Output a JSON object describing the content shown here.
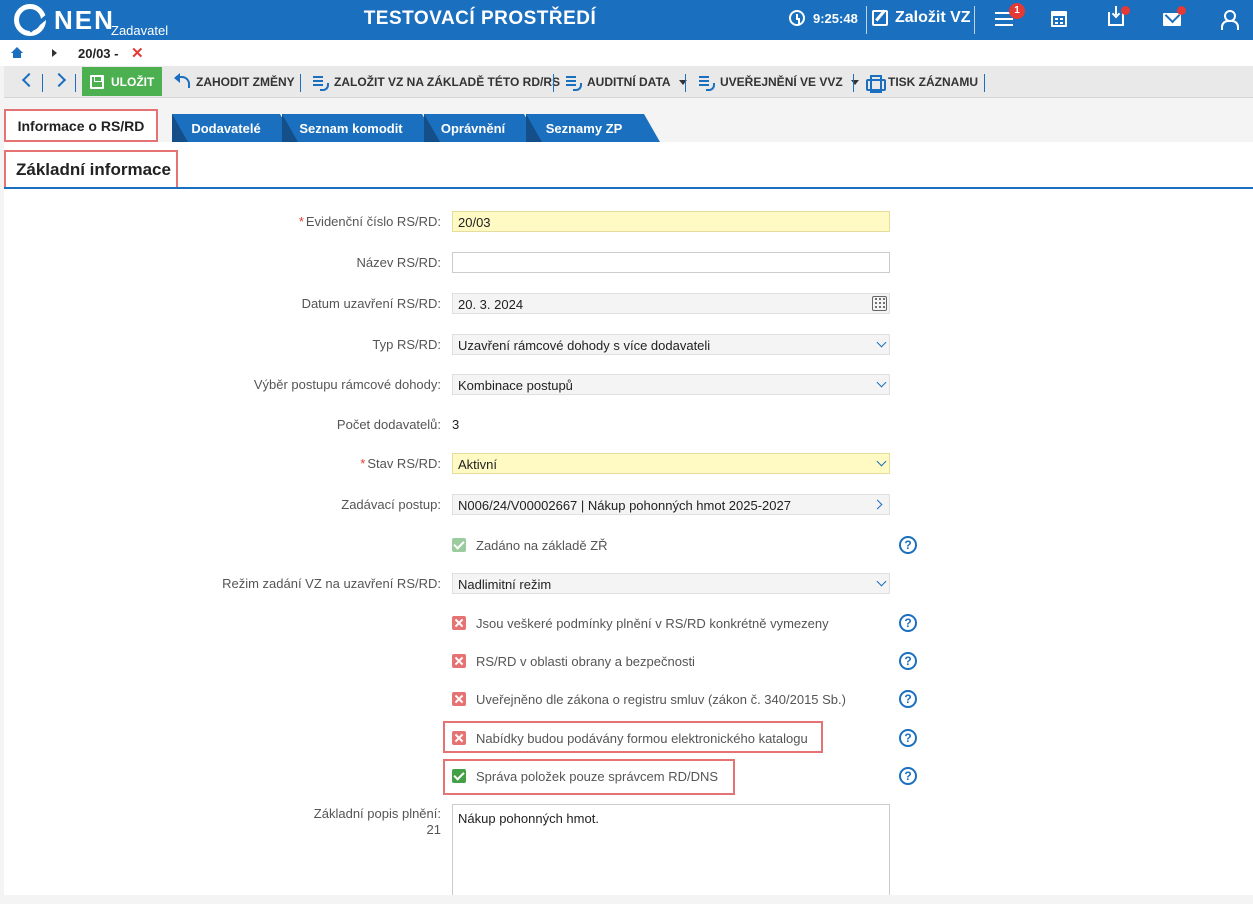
{
  "header": {
    "logo": "NEN",
    "logo_sub": "Zadavatel",
    "env_title": "TESTOVACÍ PROSTŘEDÍ",
    "time": "9:25:48",
    "create_label": "Založit VZ",
    "menu_badge": "1",
    "icons": [
      "clock-icon",
      "edit-icon",
      "menu-icon",
      "calculator-icon",
      "inbox-icon",
      "mail-icon",
      "user-icon"
    ],
    "accent_color": "#1b6fbf"
  },
  "breadcrumb": {
    "current": "20/03 -"
  },
  "toolbar": {
    "save": "ULOŽIT",
    "discard": "ZAHODIT ZMĚNY",
    "create_from": "ZALOŽIT VZ NA ZÁKLADĚ TÉTO RD/RS",
    "audit": "AUDITNÍ DATA",
    "publish": "UVEŘEJNĚNÍ VE VVZ",
    "print": "TISK ZÁZNAMU"
  },
  "tabs": {
    "active": "Informace o RS/RD",
    "items": [
      "Dodavatelé",
      "Seznam komodit",
      "Oprávnění",
      "Seznamy ZP"
    ]
  },
  "section": {
    "title": "Základní informace"
  },
  "form": {
    "evidencni_label": "Evidenční číslo RS/RD:",
    "evidencni_value": "20/03",
    "nazev_label": "Název RS/RD:",
    "nazev_value": "",
    "datum_label": "Datum uzavření RS/RD:",
    "datum_value": "20. 3. 2024",
    "typ_label": "Typ RS/RD:",
    "typ_value": "Uzavření rámcové dohody s více dodavateli",
    "vyber_label": "Výběr postupu rámcové dohody:",
    "vyber_value": "Kombinace postupů",
    "pocet_label": "Počet dodavatelů:",
    "pocet_value": "3",
    "stav_label": "Stav RS/RD:",
    "stav_value": "Aktivní",
    "postup_label": "Zadávací postup:",
    "postup_value": "N006/24/V00002667 | Nákup pohonných hmot 2025-2027",
    "zadano_label": "Zadáno na základě ZŘ",
    "rezim_label": "Režim zadání VZ na uzavření RS/RD:",
    "rezim_value": "Nadlimitní režim",
    "cb1": "Jsou veškeré podmínky plnění v RS/RD konkrétně vymezeny",
    "cb2": "RS/RD v oblasti obrany a bezpečnosti",
    "cb3": "Uveřejněno dle zákona o registru smluv (zákon č. 340/2015 Sb.)",
    "cb4": "Nabídky budou podávány formou elektronického katalogu",
    "cb5": "Správa položek pouze správcem RD/DNS",
    "popis_label": "Základní popis plnění:",
    "popis_count": "21",
    "popis_value": "Nákup pohonných hmot."
  }
}
